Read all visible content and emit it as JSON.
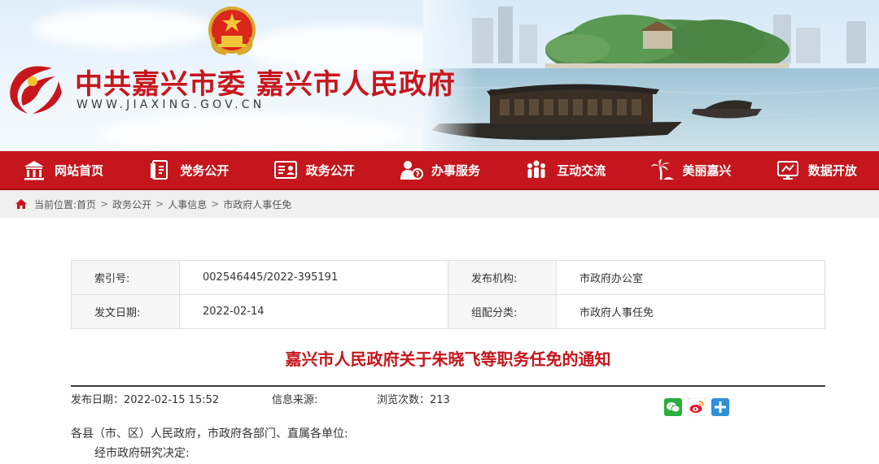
{
  "header": {
    "site_title": "中共嘉兴市委 嘉兴市人民政府",
    "site_url": "WWW.JIAXING.GOV.CN"
  },
  "nav": {
    "items": [
      {
        "label": "网站首页",
        "icon": "home-building-icon"
      },
      {
        "label": "党务公开",
        "icon": "party-document-icon"
      },
      {
        "label": "政务公开",
        "icon": "id-card-icon"
      },
      {
        "label": "办事服务",
        "icon": "service-person-icon"
      },
      {
        "label": "互动交流",
        "icon": "people-group-icon"
      },
      {
        "label": "美丽嘉兴",
        "icon": "palm-tree-icon"
      },
      {
        "label": "数据开放",
        "icon": "data-screen-icon"
      }
    ]
  },
  "breadcrumb": {
    "prefix": "当前位置:",
    "items": [
      "首页",
      "政务公开",
      "人事信息",
      "市政府人事任免"
    ],
    "sep": ">"
  },
  "info": {
    "index_label": "索引号:",
    "index_value": "002546445/2022-395191",
    "publisher_label": "发布机构:",
    "publisher_value": "市政府办公室",
    "date_label": "发文日期:",
    "date_value": "2022-02-14",
    "category_label": "组配分类:",
    "category_value": "市政府人事任免"
  },
  "article": {
    "title": "嘉兴市人民政府关于朱晓飞等职务任免的通知",
    "publish_time": "发布日期：2022-02-15 15:52",
    "source": "信息来源:",
    "views": "浏览次数：213",
    "para1": "各县（市、区）人民政府，市政府各部门、直属各单位:",
    "para2": "经市政府研究决定:"
  },
  "colors": {
    "brand_red": "#c4161c",
    "nav_red": "#c4161c",
    "breadcrumb_bg": "#f0f0f0"
  },
  "share": {
    "wechat": "wechat-icon",
    "weibo": "weibo-icon",
    "more": "plus-icon"
  }
}
